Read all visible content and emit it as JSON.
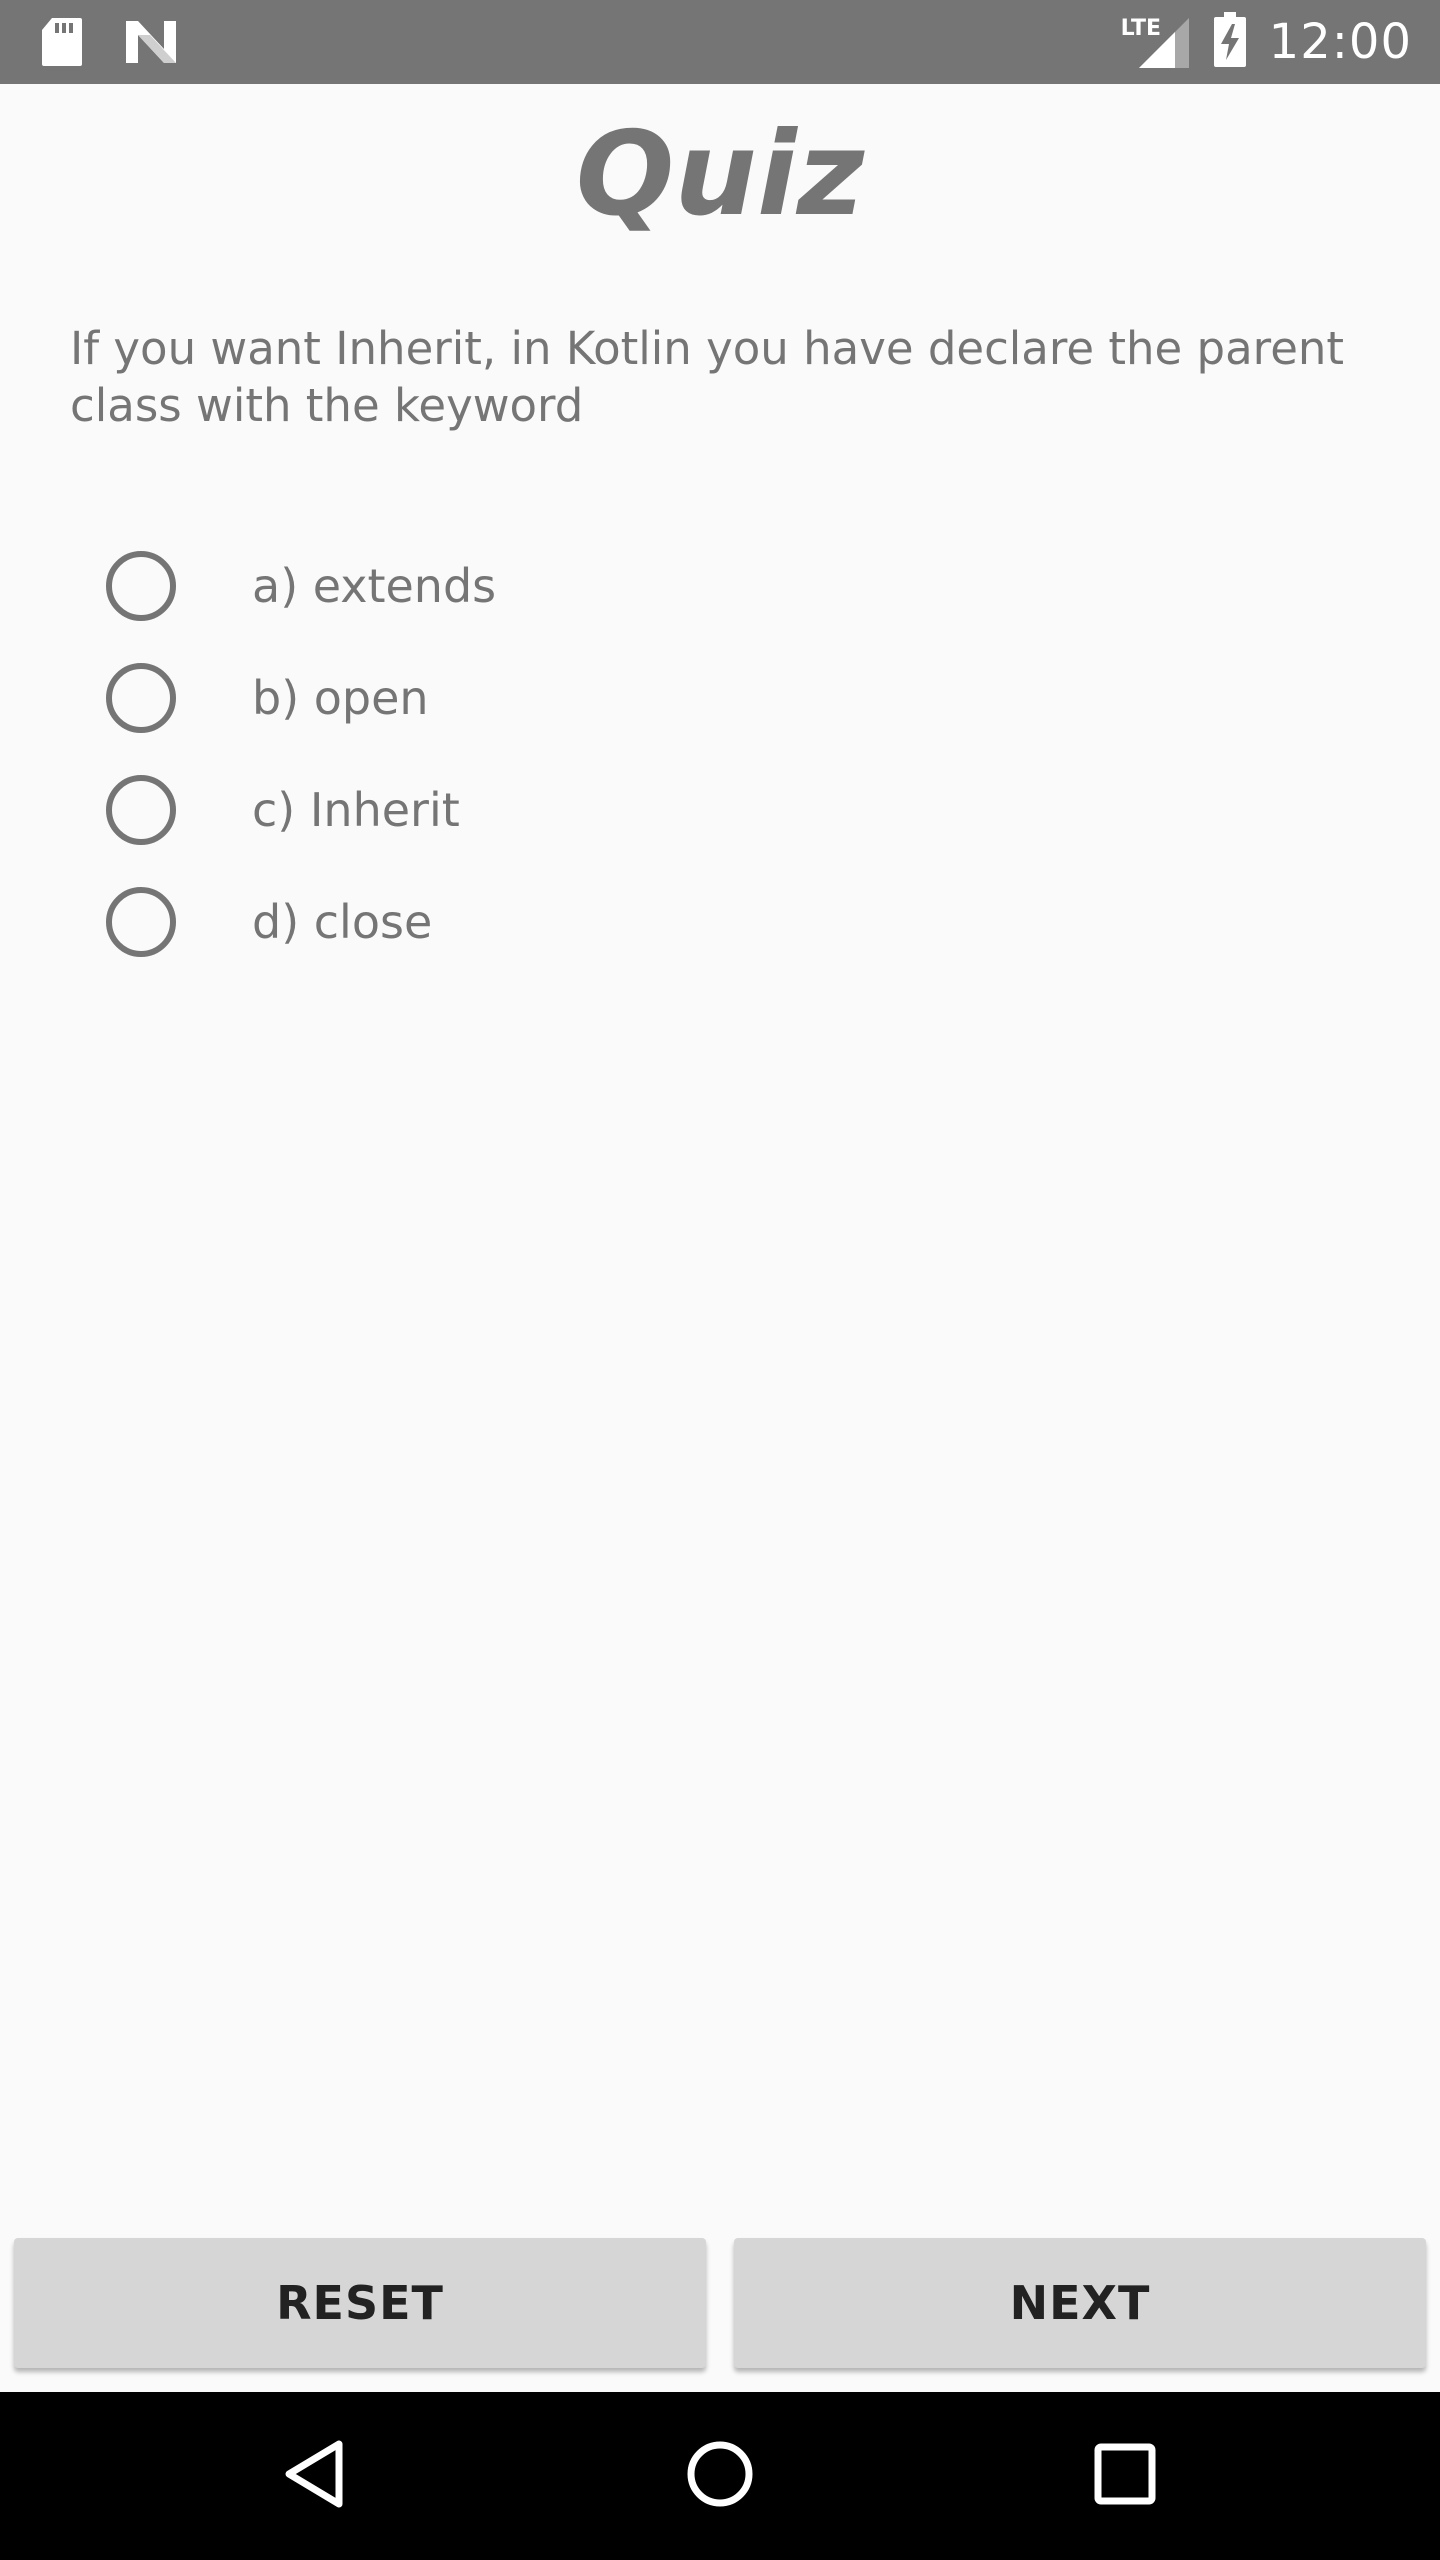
{
  "status_bar": {
    "time": "12:00",
    "network_label": "LTE",
    "icons": [
      "sd-card-icon",
      "app-n-icon",
      "cell-signal-icon",
      "battery-charging-icon"
    ]
  },
  "quiz": {
    "title": "Quiz",
    "question": "If you want Inherit, in Kotlin you have declare the parent class with the keyword",
    "options": [
      {
        "label": "a) extends",
        "selected": false
      },
      {
        "label": "b) open",
        "selected": false
      },
      {
        "label": "c) Inherit",
        "selected": false
      },
      {
        "label": "d) close",
        "selected": false
      }
    ]
  },
  "actions": {
    "reset_label": "RESET",
    "next_label": "NEXT"
  },
  "nav_bar": {
    "icons": [
      "back-icon",
      "home-icon",
      "recents-icon"
    ]
  },
  "colors": {
    "status_bar_bg": "#757575",
    "text_gray": "#757575",
    "button_bg": "#d6d6d6",
    "page_bg": "#fafafa",
    "nav_bar_bg": "#000000"
  }
}
